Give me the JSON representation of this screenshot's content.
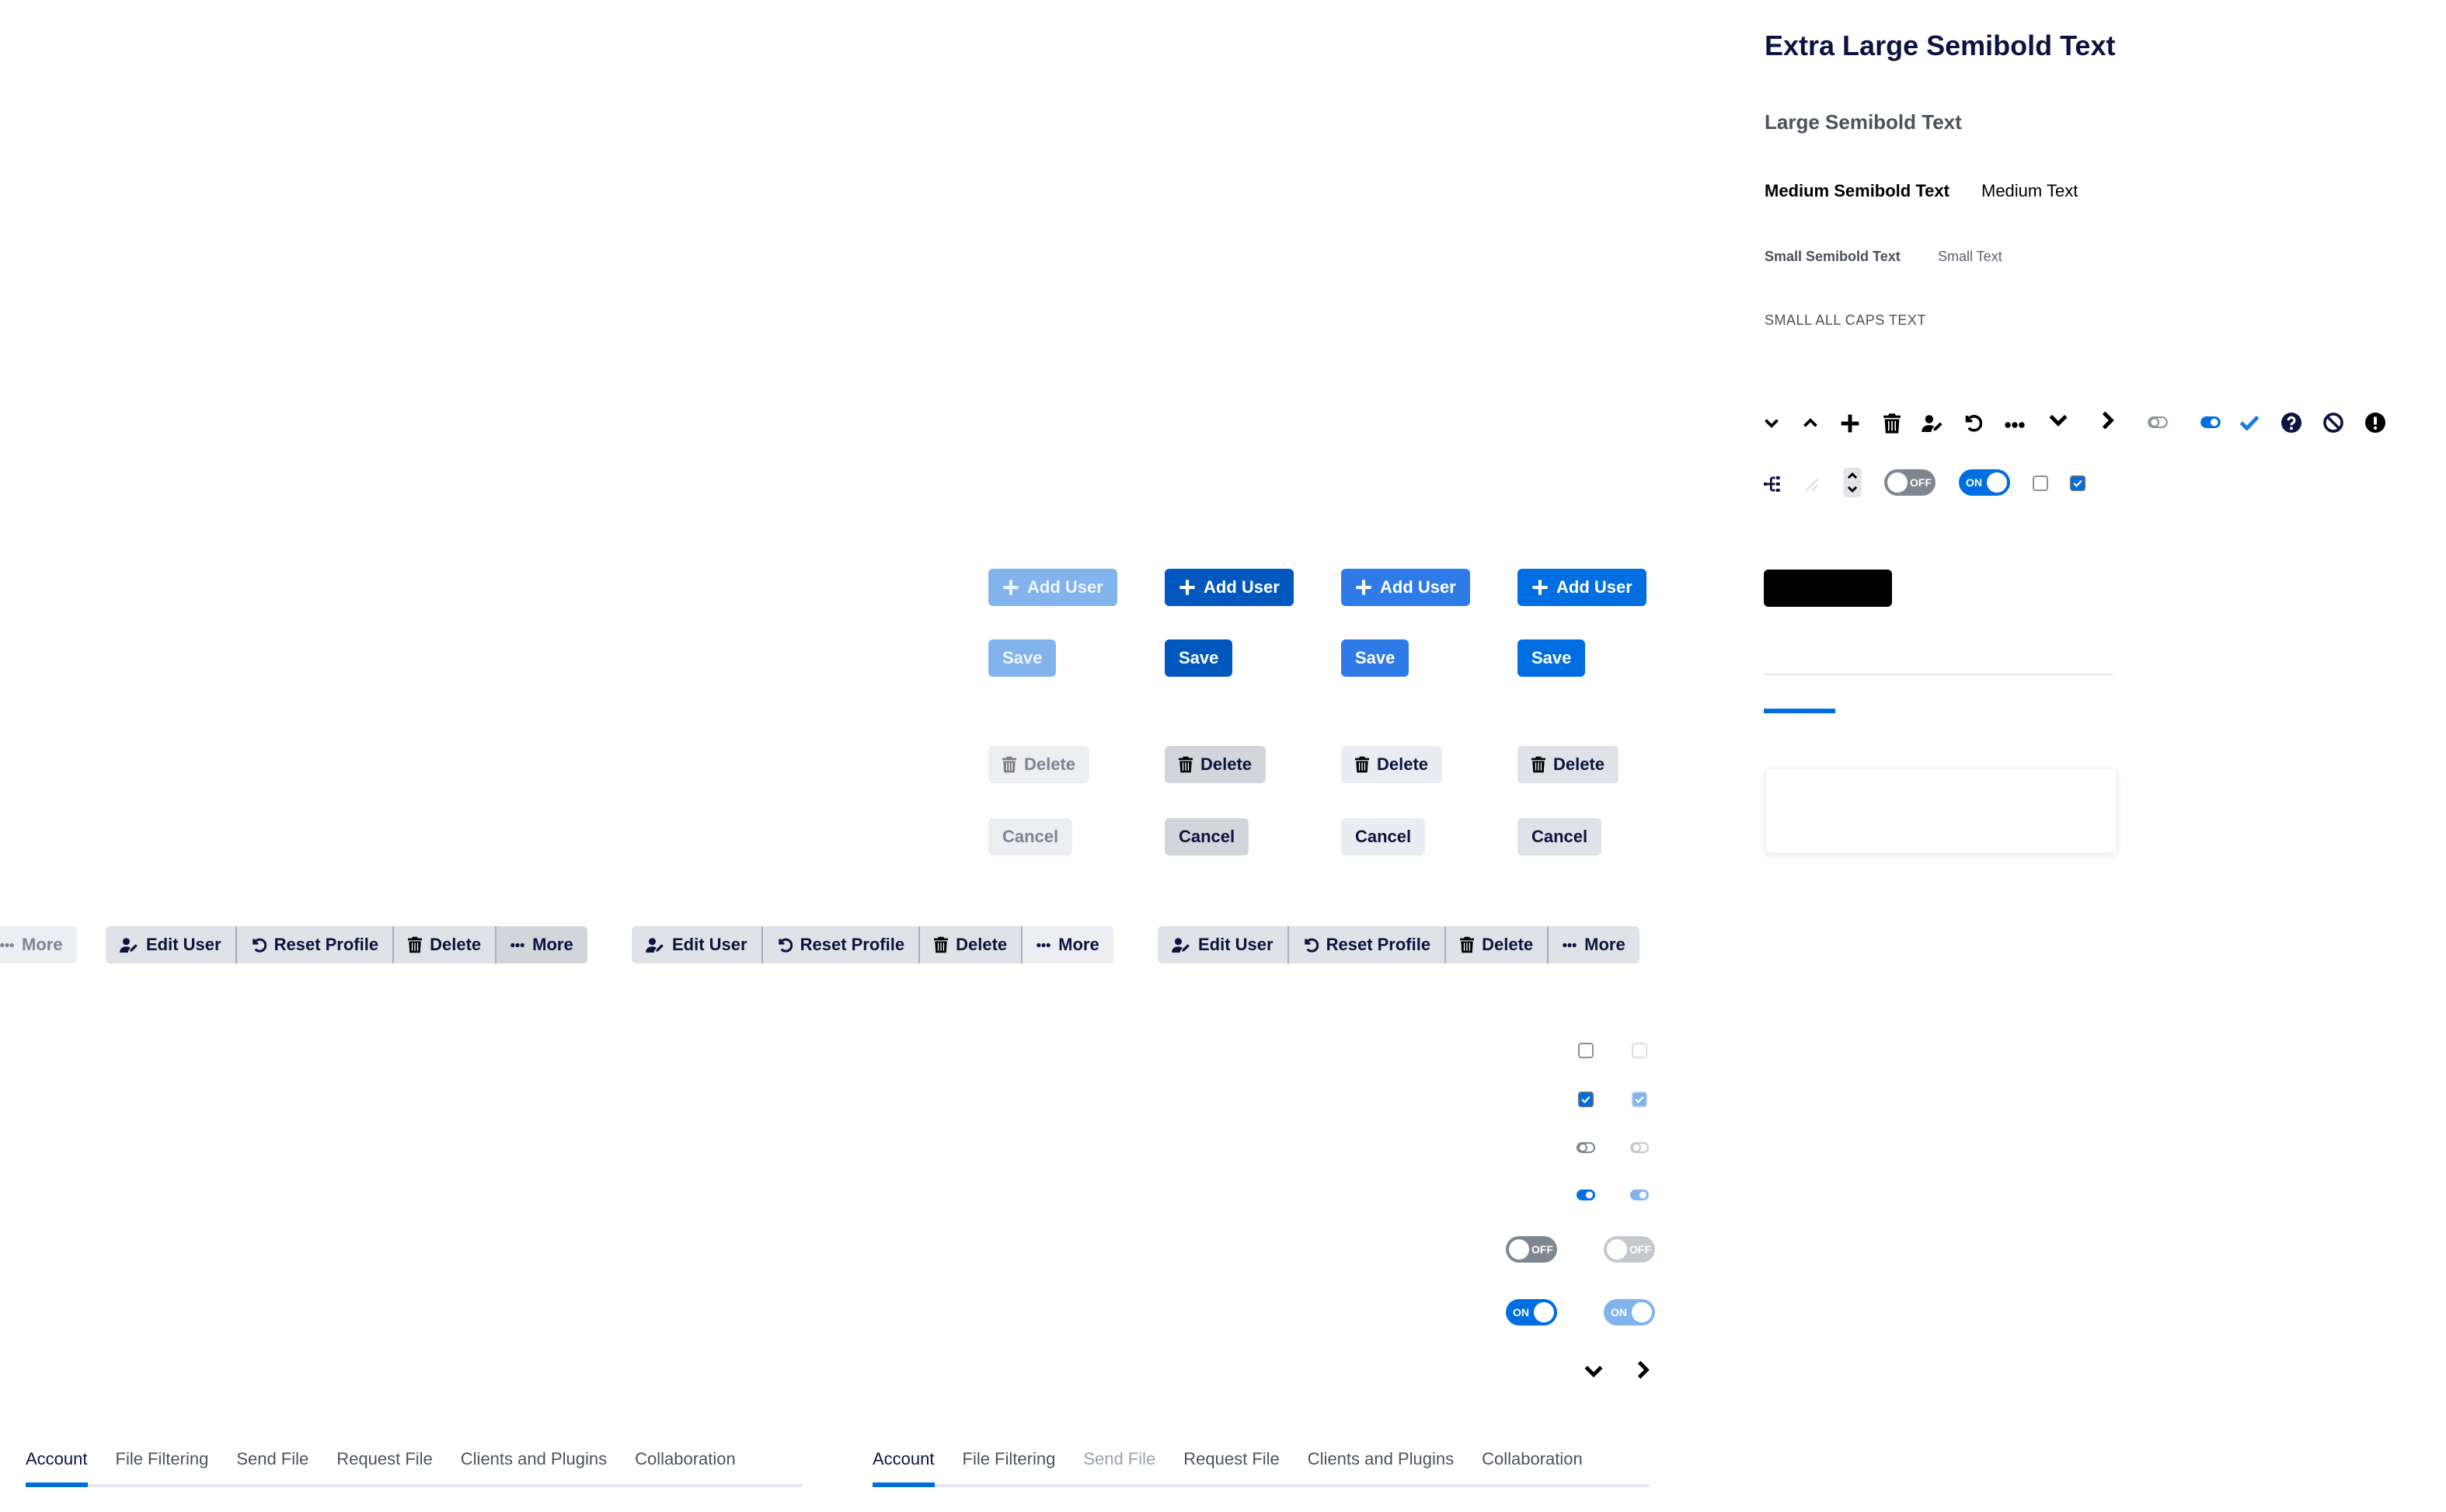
{
  "typography": {
    "extra_large_semibold": "Extra Large Semibold Text",
    "large_semibold": "Large Semibold Text",
    "medium_semibold": "Medium Semibold Text",
    "medium": "Medium Text",
    "small_semibold": "Small Semibold Text",
    "small": "Small Text",
    "small_all_caps": "SMALL ALL CAPS TEXT"
  },
  "icon_row_1": [
    "chevron-down-small",
    "chevron-up-small",
    "plus",
    "trash",
    "user-edit",
    "undo",
    "ellipsis",
    "chevron-down",
    "chevron-right",
    "toggle-off",
    "toggle-on",
    "check",
    "question-circle",
    "ban",
    "exclamation-circle"
  ],
  "icon_row_2": {
    "icons": [
      "sitemap",
      "resize-handle",
      "spinner-arrows"
    ],
    "toggle_off_label": "OFF",
    "toggle_on_label": "ON",
    "checkbox_unchecked": false,
    "checkbox_checked": true
  },
  "buttons": {
    "add_user": "Add User",
    "save": "Save",
    "delete": "Delete",
    "cancel": "Cancel",
    "states": [
      "disabled",
      "active",
      "hover",
      "default"
    ]
  },
  "button_groups": {
    "partial_more": "More",
    "items": [
      "Edit User",
      "Reset Profile",
      "Delete",
      "More"
    ]
  },
  "controls": {
    "toggle_off_label": "OFF",
    "toggle_on_label": "ON"
  },
  "tabs_1": {
    "items": [
      "Account",
      "File Filtering",
      "Send File",
      "Request File",
      "Clients and Plugins",
      "Collaboration"
    ],
    "active": "Account"
  },
  "tabs_2": {
    "items": [
      "Account",
      "File Filtering",
      "Send File",
      "Request File",
      "Clients and Plugins",
      "Collaboration"
    ],
    "active": "Account",
    "disabled": "Send File"
  },
  "colors": {
    "primary": "#006ee0",
    "primary_active": "#0058bf",
    "primary_hover": "#2e7be8",
    "primary_disabled": "#82b3ec",
    "secondary": "#dfe2e7",
    "text_dark": "#0b1440"
  }
}
